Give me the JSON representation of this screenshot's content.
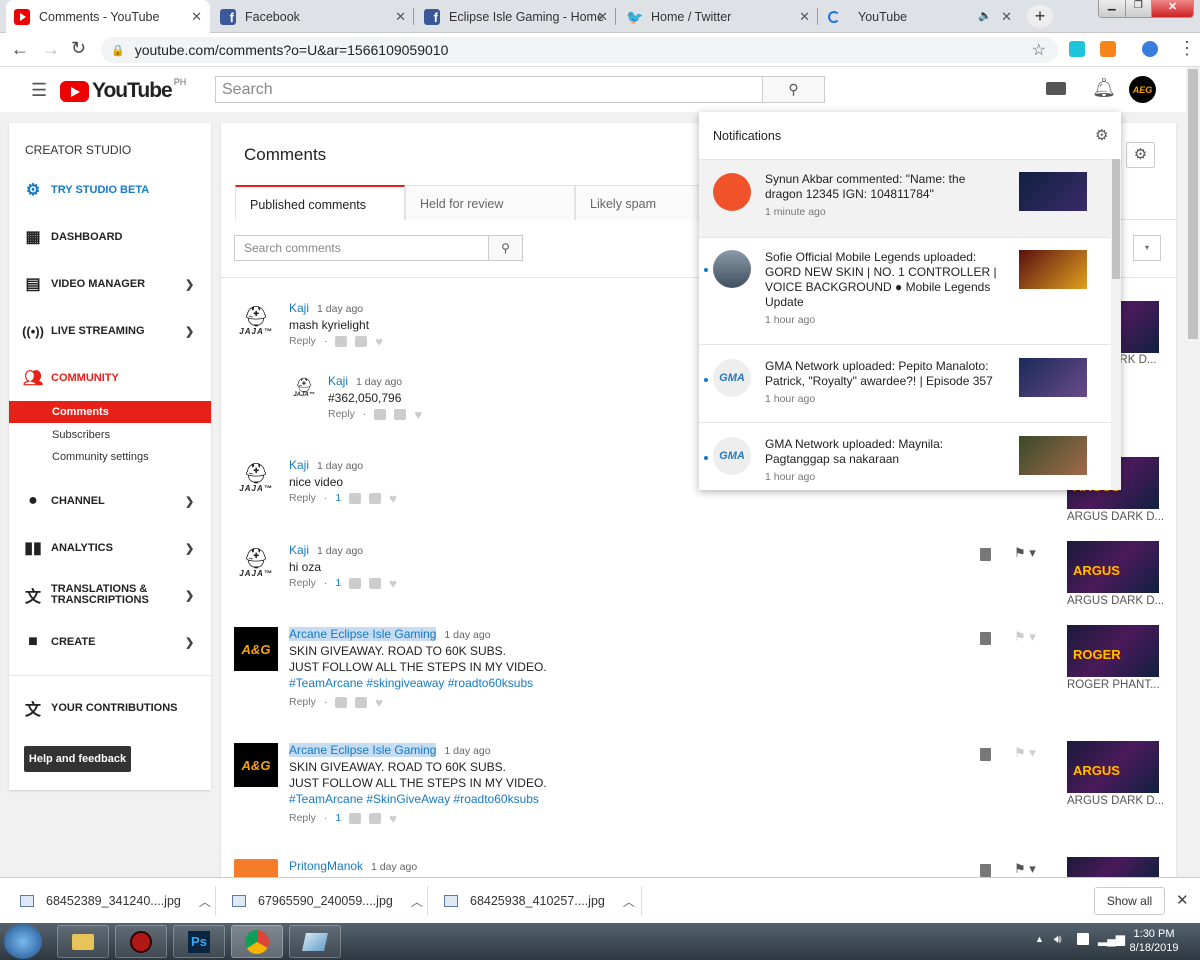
{
  "browser": {
    "tabs": [
      {
        "label": "Comments - YouTube",
        "icon": "youtube-icon"
      },
      {
        "label": "Facebook",
        "icon": "facebook-icon"
      },
      {
        "label": "Eclipse Isle Gaming - Home",
        "icon": "facebook-icon"
      },
      {
        "label": "Home / Twitter",
        "icon": "twitter-icon"
      },
      {
        "label": "YouTube",
        "icon": "loading-icon"
      }
    ],
    "url": "youtube.com/comments?o=U&ar=1566109059010"
  },
  "youtube": {
    "logo": "YouTube",
    "region": "PH",
    "search_placeholder": "Search",
    "avatar_text": "AEG"
  },
  "sidebar": {
    "title": "CREATOR STUDIO",
    "studio_beta": "TRY STUDIO BETA",
    "items": [
      {
        "label": "DASHBOARD",
        "icon": "dashboard-icon"
      },
      {
        "label": "VIDEO MANAGER",
        "icon": "video-manager-icon"
      },
      {
        "label": "LIVE STREAMING",
        "icon": "live-streaming-icon"
      },
      {
        "label": "COMMUNITY",
        "icon": "community-icon"
      },
      {
        "label": "CHANNEL",
        "icon": "channel-icon"
      },
      {
        "label": "ANALYTICS",
        "icon": "analytics-icon"
      },
      {
        "label": "TRANSLATIONS & TRANSCRIPTIONS",
        "icon": "translate-icon"
      },
      {
        "label": "CREATE",
        "icon": "create-icon"
      },
      {
        "label": "YOUR CONTRIBUTIONS",
        "icon": "contributions-icon"
      }
    ],
    "community_sub": [
      "Comments",
      "Subscribers",
      "Community settings"
    ],
    "help_button": "Help and feedback",
    "accent": "#e62117"
  },
  "comments_page": {
    "title": "Comments",
    "tabs": [
      "Published comments",
      "Held for review",
      "Likely spam"
    ],
    "search_placeholder": "Search comments",
    "reply_label": "Reply",
    "comments": [
      {
        "author": "Kaji",
        "time": "1 day ago",
        "lines": [
          "mash kyrielight"
        ],
        "likes": "",
        "avatar": "jaja"
      },
      {
        "author": "Kaji",
        "time": "1 day ago",
        "lines": [
          "#362,050,796"
        ],
        "likes": "",
        "avatar": "jaja",
        "reply": true
      },
      {
        "author": "Kaji",
        "time": "1 day ago",
        "lines": [
          "nice video"
        ],
        "likes": "1",
        "avatar": "jaja"
      },
      {
        "author": "Kaji",
        "time": "1 day ago",
        "lines": [
          "hi oza"
        ],
        "likes": "1",
        "avatar": "jaja"
      },
      {
        "author": "Arcane Eclipse Isle Gaming",
        "time": "1 day ago",
        "lines": [
          "SKIN GIVEAWAY. ROAD TO 60K SUBS.",
          "JUST FOLLOW ALL THE STEPS IN MY VIDEO."
        ],
        "hashtags": "#TeamArcane #skingiveaway #roadto60ksubs",
        "likes": "",
        "avatar": "aeg"
      },
      {
        "author": "Arcane Eclipse Isle Gaming",
        "time": "1 day ago",
        "lines": [
          "SKIN GIVEAWAY. ROAD TO 60K SUBS.",
          "JUST FOLLOW ALL THE STEPS IN MY VIDEO."
        ],
        "hashtags": "#TeamArcane #SkinGiveAway #roadto60ksubs",
        "likes": "1",
        "avatar": "aeg"
      },
      {
        "author": "PritongManok",
        "time": "1 day ago",
        "lines": [],
        "likes": "",
        "avatar": "orange"
      }
    ],
    "videos": [
      {
        "caption": "ARGUS DARK D...",
        "thumb": "ARGUS"
      },
      {
        "caption": "ARGUS DARK D...",
        "thumb": "ARGUS"
      },
      {
        "caption": "ROGER PHANT...",
        "thumb": "ROGER"
      },
      {
        "caption": "ARGUS DARK D...",
        "thumb": "ARGUS"
      }
    ],
    "partial_caption": "RGUS DARK D..."
  },
  "notifications": {
    "title": "Notifications",
    "items": [
      {
        "text": "Synun Akbar commented: \"Name: the dragon 12345 IGN: 104811784\"",
        "time": "1 minute ago"
      },
      {
        "text": "Sofie Official Mobile Legends uploaded: GORD NEW SKIN | NO. 1 CONTROLLER | VOICE BACKGROUND ● Mobile Legends Update",
        "time": "1 hour ago"
      },
      {
        "text": "GMA Network uploaded: Pepito Manaloto: Patrick, \"Royalty\" awardee?! | Episode 357",
        "time": "1 hour ago"
      },
      {
        "text": "GMA Network uploaded: Maynila: Pagtanggap sa nakaraan",
        "time": "1 hour ago"
      }
    ],
    "gma_logo": "GMA"
  },
  "downloads": {
    "files": [
      "68452389_341240....jpg",
      "67965590_240059....jpg",
      "68425938_410257....jpg"
    ],
    "show_all": "Show all"
  },
  "taskbar": {
    "time": "1:30 PM",
    "date": "8/18/2019",
    "ps_label": "Ps"
  }
}
